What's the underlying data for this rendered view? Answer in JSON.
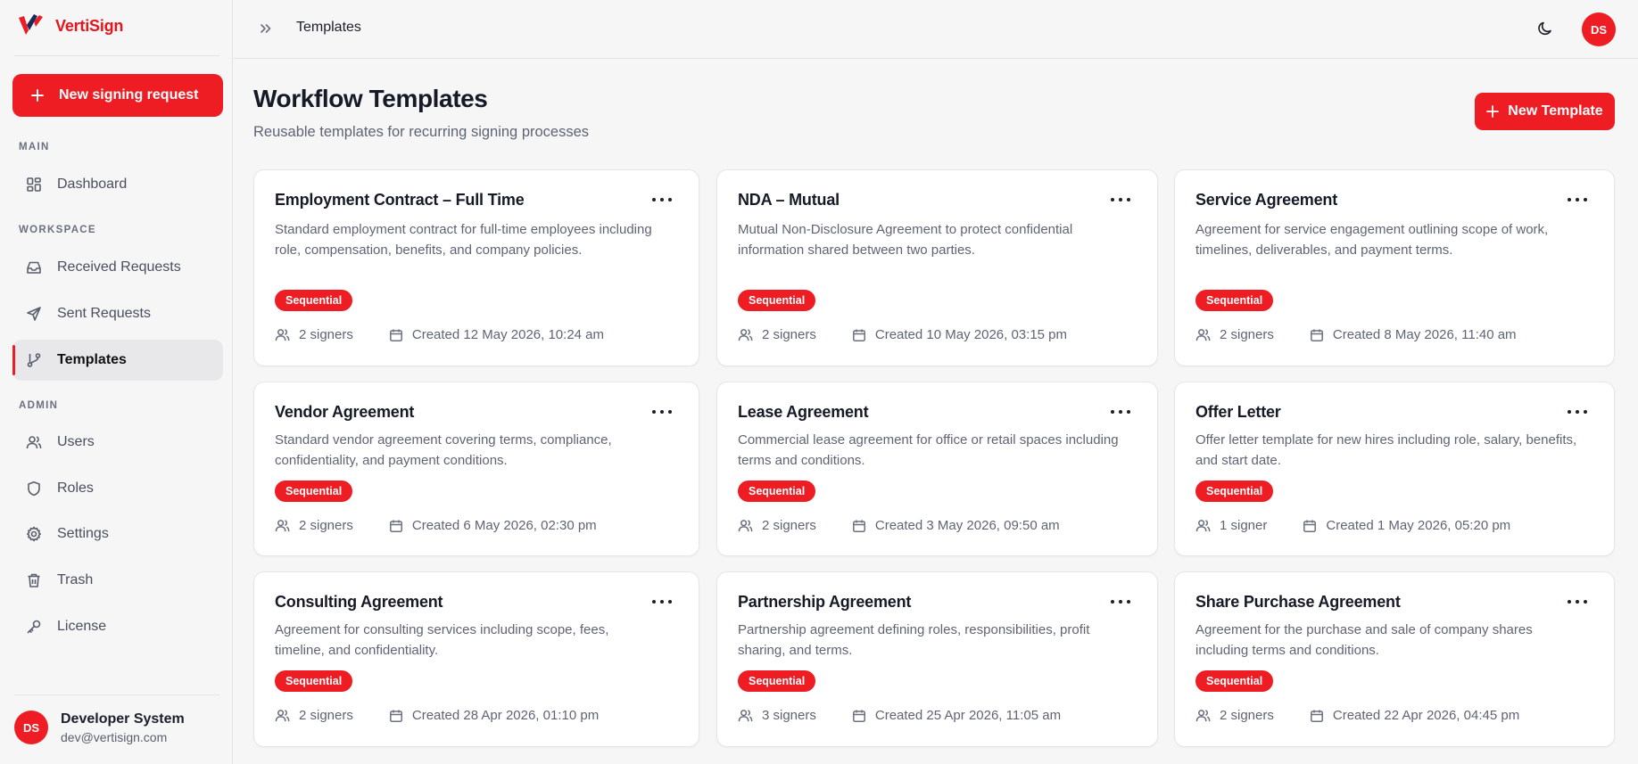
{
  "app": {
    "brand_name": "VertiSign",
    "accent_color": "#ee1c23"
  },
  "sidebar": {
    "new_request_label": "New signing request",
    "sections": {
      "main": "MAIN",
      "workspace": "WORKSPACE",
      "admin": "ADMIN"
    },
    "items": [
      {
        "label": "Dashboard",
        "icon": "dashboard-icon"
      },
      {
        "label": "Received Requests",
        "icon": "inbox-icon"
      },
      {
        "label": "Sent Requests",
        "icon": "send-icon"
      },
      {
        "label": "Templates",
        "icon": "branch-icon",
        "active": true
      },
      {
        "label": "Users",
        "icon": "users-icon"
      },
      {
        "label": "Roles",
        "icon": "shield-icon"
      },
      {
        "label": "Settings",
        "icon": "gear-icon"
      },
      {
        "label": "Trash",
        "icon": "trash-icon"
      },
      {
        "label": "License",
        "icon": "key-icon"
      }
    ],
    "user": {
      "initials": "DS",
      "name": "Developer System",
      "email": "dev@vertisign.com"
    }
  },
  "topbar": {
    "breadcrumb": "Templates",
    "avatar_initials": "DS"
  },
  "page": {
    "title": "Workflow Templates",
    "subtitle": "Reusable templates for recurring signing processes",
    "new_template_label": "New Template"
  },
  "templates": [
    {
      "title": "Employment Contract – Full Time",
      "description": "Standard employment contract for full-time employees including role, compensation, benefits, and company policies.",
      "badge": "Sequential",
      "signers": "2 signers",
      "created": "Created 12 May 2026, 10:24 am"
    },
    {
      "title": "NDA – Mutual",
      "description": "Mutual Non-Disclosure Agreement to protect confidential information shared between two parties.",
      "badge": "Sequential",
      "signers": "2 signers",
      "created": "Created 10 May 2026, 03:15 pm"
    },
    {
      "title": "Service Agreement",
      "description": "Agreement for service engagement outlining scope of work, timelines, deliverables, and payment terms.",
      "badge": "Sequential",
      "signers": "2 signers",
      "created": "Created 8 May 2026, 11:40 am"
    },
    {
      "title": "Vendor Agreement",
      "description": "Standard vendor agreement covering terms, compliance, confidentiality, and payment conditions.",
      "badge": "Sequential",
      "signers": "2 signers",
      "created": "Created 6 May 2026, 02:30 pm"
    },
    {
      "title": "Lease Agreement",
      "description": "Commercial lease agreement for office or retail spaces including terms and conditions.",
      "badge": "Sequential",
      "signers": "2 signers",
      "created": "Created 3 May 2026, 09:50 am"
    },
    {
      "title": "Offer Letter",
      "description": "Offer letter template for new hires including role, salary, benefits, and start date.",
      "badge": "Sequential",
      "signers": "1 signer",
      "created": "Created 1 May 2026, 05:20 pm"
    },
    {
      "title": "Consulting Agreement",
      "description": "Agreement for consulting services including scope, fees, timeline, and confidentiality.",
      "badge": "Sequential",
      "signers": "2 signers",
      "created": "Created 28 Apr 2026, 01:10 pm"
    },
    {
      "title": "Partnership Agreement",
      "description": "Partnership agreement defining roles, responsibilities, profit sharing, and terms.",
      "badge": "Sequential",
      "signers": "3 signers",
      "created": "Created 25 Apr 2026, 11:05 am"
    },
    {
      "title": "Share Purchase Agreement",
      "description": "Agreement for the purchase and sale of company shares including terms and conditions.",
      "badge": "Sequential",
      "signers": "2 signers",
      "created": "Created 22 Apr 2026, 04:45 pm"
    }
  ]
}
